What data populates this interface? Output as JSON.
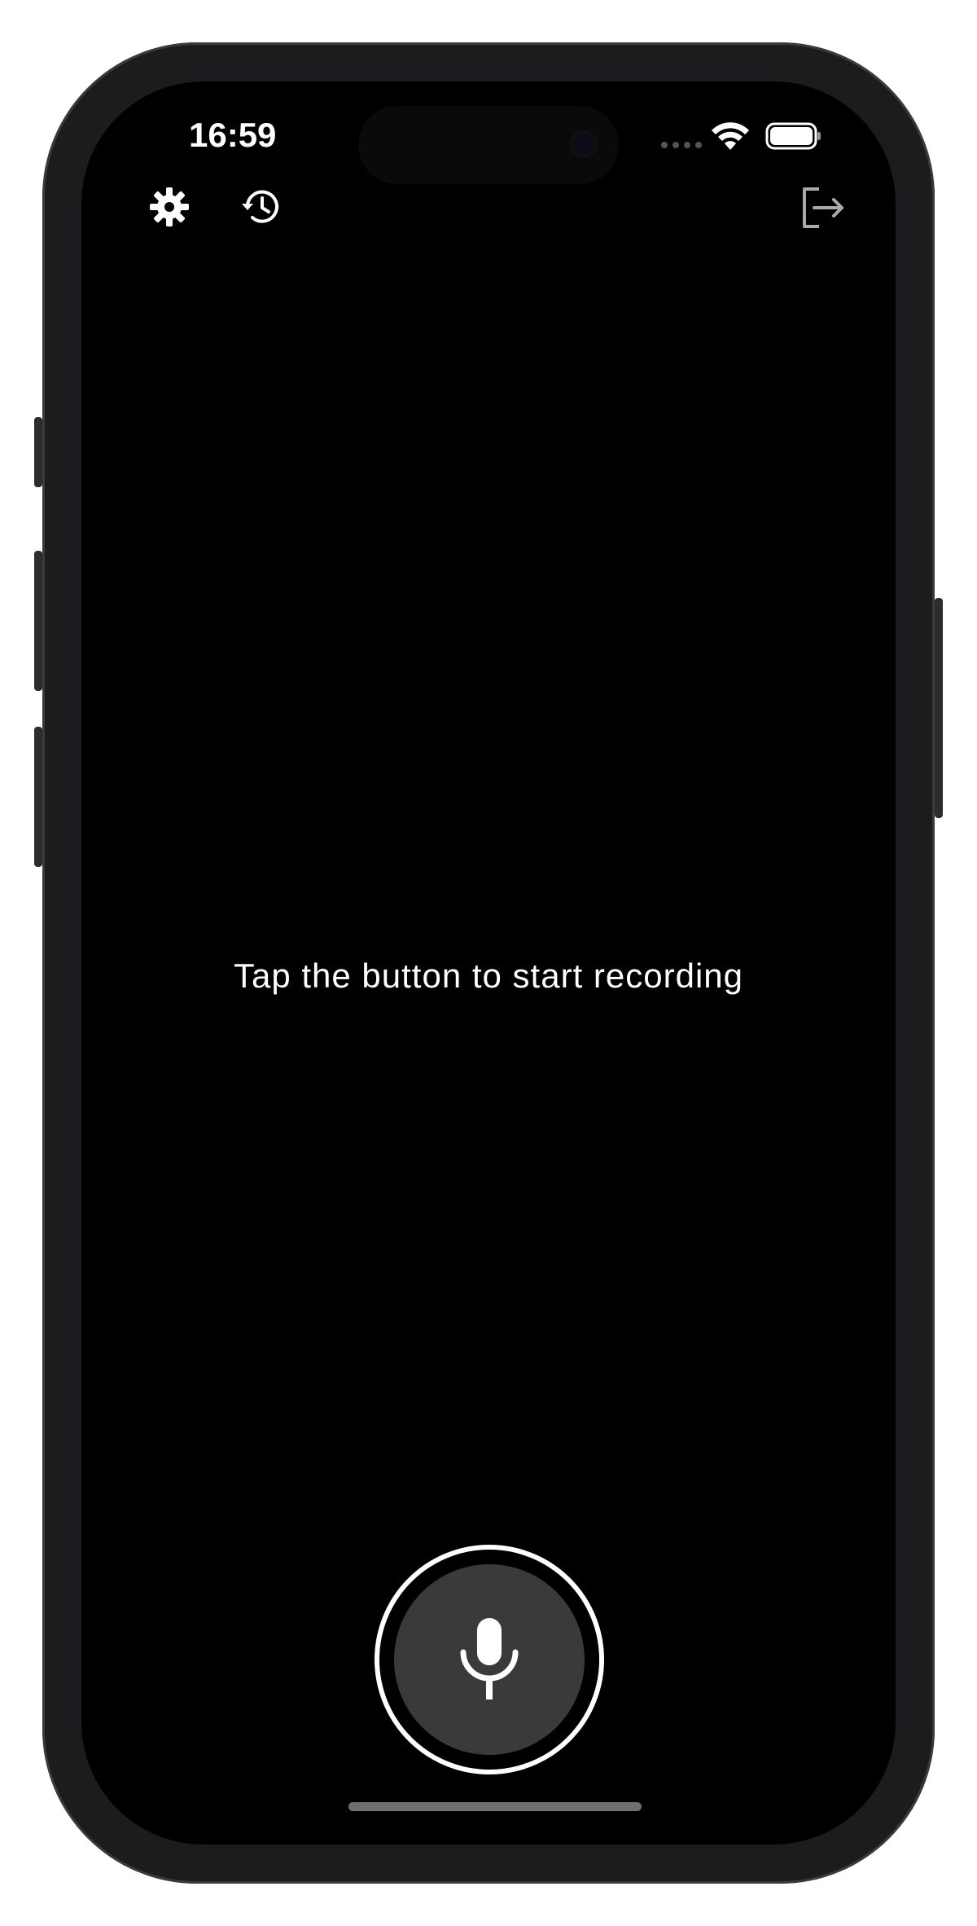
{
  "status_bar": {
    "time": "16:59",
    "icons": [
      "wifi-icon",
      "battery-icon"
    ]
  },
  "toolbar": {
    "left_icons": [
      "gear-icon",
      "history-icon"
    ],
    "right_icons": [
      "logout-icon"
    ]
  },
  "main": {
    "prompt": "Tap the button to start recording"
  },
  "record_button": {
    "icon": "microphone-icon"
  },
  "colors": {
    "background": "#000000",
    "text": "#ffffff",
    "button_fill": "#3a3a3c",
    "button_ring": "#ffffff"
  }
}
